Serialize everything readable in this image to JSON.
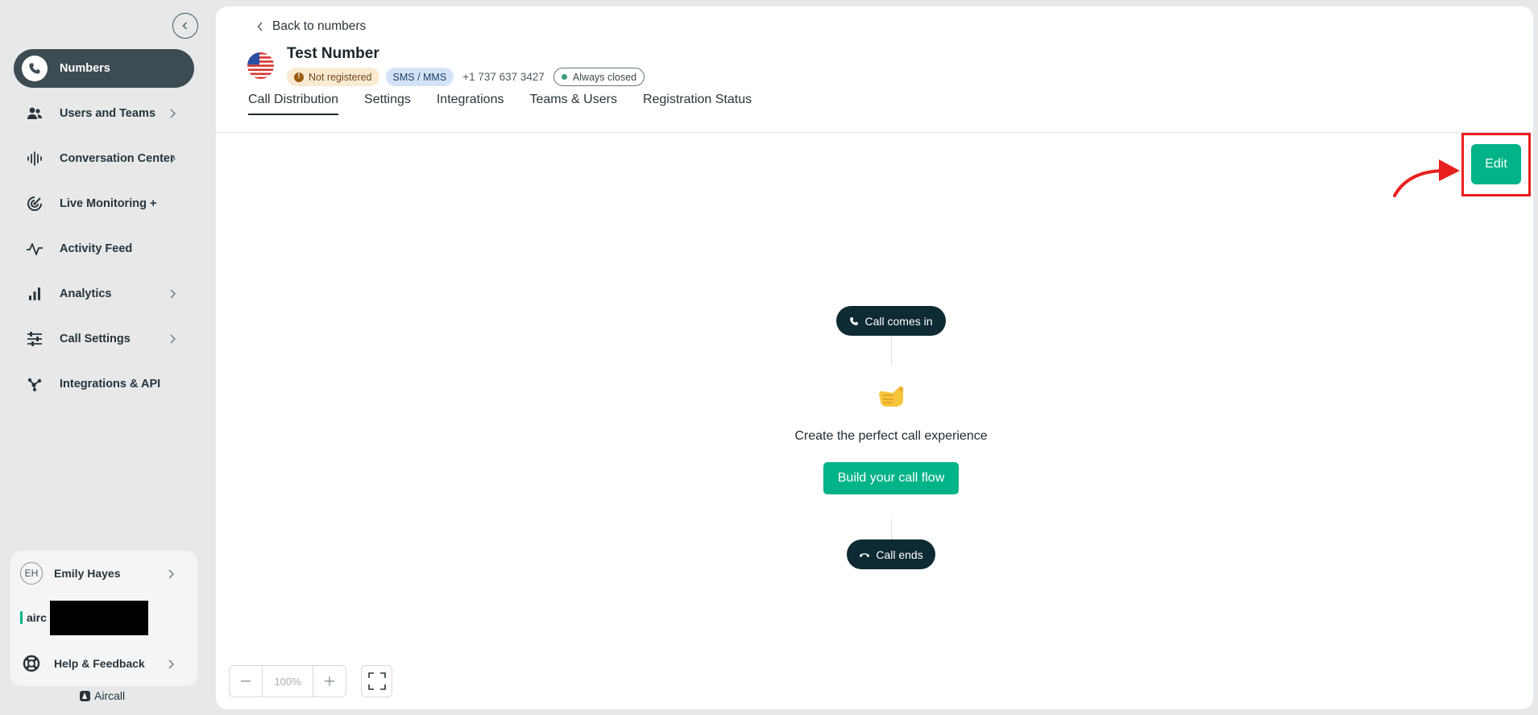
{
  "sidebar": {
    "items": [
      {
        "label": "Numbers",
        "icon": "phone-icon",
        "active": true,
        "has_chevron": false
      },
      {
        "label": "Users and Teams",
        "icon": "users-icon",
        "active": false,
        "has_chevron": true
      },
      {
        "label": "Conversation Center",
        "icon": "waveform-icon",
        "active": false,
        "has_chevron": true
      },
      {
        "label": "Live Monitoring +",
        "icon": "live-monitoring-icon",
        "active": false,
        "has_chevron": false
      },
      {
        "label": "Activity Feed",
        "icon": "activity-icon",
        "active": false,
        "has_chevron": false
      },
      {
        "label": "Analytics",
        "icon": "bar-chart-icon",
        "active": false,
        "has_chevron": true
      },
      {
        "label": "Call Settings",
        "icon": "sliders-icon",
        "active": false,
        "has_chevron": true
      },
      {
        "label": "Integrations & API",
        "icon": "integrations-icon",
        "active": false,
        "has_chevron": false
      }
    ],
    "user": {
      "initials": "EH",
      "name": "Emily Hayes"
    },
    "brand_partial": "airc",
    "help_label": "Help & Feedback",
    "footer_brand": "Aircall"
  },
  "header": {
    "back_label": "Back to numbers",
    "title": "Test Number",
    "badge_status": "Not registered",
    "badge_type": "SMS / MMS",
    "phone_number": "+1 737 637 3427",
    "badge_hours": "Always closed"
  },
  "tabs": [
    {
      "label": "Call Distribution",
      "active": true
    },
    {
      "label": "Settings",
      "active": false
    },
    {
      "label": "Integrations",
      "active": false
    },
    {
      "label": "Teams & Users",
      "active": false
    },
    {
      "label": "Registration Status",
      "active": false
    }
  ],
  "edit_label": "Edit",
  "flow": {
    "start_label": "Call comes in",
    "empty_text": "Create the perfect call experience",
    "build_label": "Build your call flow",
    "end_label": "Call ends"
  },
  "zoom": {
    "value": "100%"
  },
  "colors": {
    "accent": "#00b388",
    "sidebar_active": "#3d4c53",
    "pill": "#0e2a33",
    "annotation": "#e8201d"
  }
}
